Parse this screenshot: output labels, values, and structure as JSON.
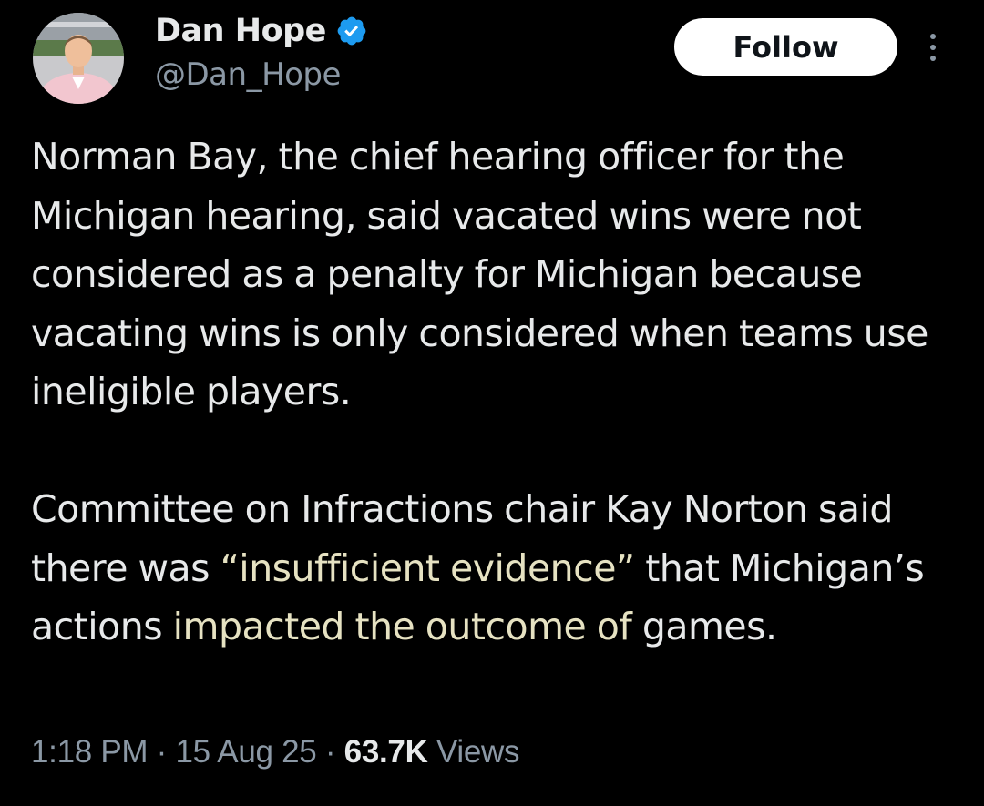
{
  "author": {
    "display_name": "Dan Hope",
    "handle": "@Dan_Hope",
    "verified": true,
    "verified_color": "#1d9bf0",
    "avatar_icon": "profile-photo"
  },
  "actions": {
    "follow_label": "Follow",
    "more_icon": "vertical-ellipsis-icon"
  },
  "tweet": {
    "paragraph1": "Norman Bay, the chief hearing officer for the Michigan hearing, said vacated wins were not considered as a penalty for Michigan because vacating wins is only considered when teams use ineligible players.",
    "paragraph2": {
      "part1": "Committee on Infractions chair Kay Norton said there was ",
      "quote": "“insufficient evidence”",
      "part2": " that Michigan’s actions ",
      "highlight": "impacted the outcome of",
      "part3": " games."
    },
    "highlight_color": "#e6e2c2"
  },
  "meta": {
    "time": "1:18 PM",
    "separator": " · ",
    "date": "15 Aug 25",
    "views_count": "63.7K",
    "views_label": " Views"
  }
}
